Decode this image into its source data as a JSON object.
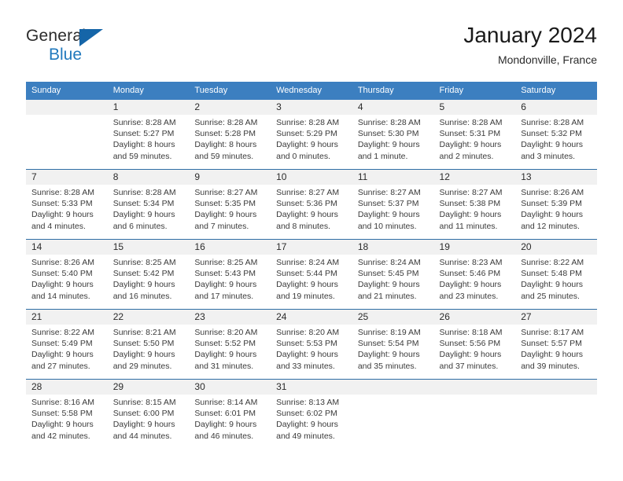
{
  "brand": {
    "name_top": "General",
    "name_bottom": "Blue",
    "triangle_icon": "triangle-logo-icon"
  },
  "header": {
    "title": "January 2024",
    "subtitle": "Mondonville, France"
  },
  "colors": {
    "header_blue": "#3c7fc0",
    "row_divider_blue": "#2e6da4",
    "daynum_band": "#f1f1f1",
    "brand_blue": "#2179bd",
    "logo_triangle": "#1565a8"
  },
  "weekday_headers": [
    "Sunday",
    "Monday",
    "Tuesday",
    "Wednesday",
    "Thursday",
    "Friday",
    "Saturday"
  ],
  "weeks": [
    [
      {
        "day": "",
        "sunrise": "",
        "sunset": "",
        "daylight_line1": "",
        "daylight_line2": ""
      },
      {
        "day": "1",
        "sunrise": "Sunrise: 8:28 AM",
        "sunset": "Sunset: 5:27 PM",
        "daylight_line1": "Daylight: 8 hours",
        "daylight_line2": "and 59 minutes."
      },
      {
        "day": "2",
        "sunrise": "Sunrise: 8:28 AM",
        "sunset": "Sunset: 5:28 PM",
        "daylight_line1": "Daylight: 8 hours",
        "daylight_line2": "and 59 minutes."
      },
      {
        "day": "3",
        "sunrise": "Sunrise: 8:28 AM",
        "sunset": "Sunset: 5:29 PM",
        "daylight_line1": "Daylight: 9 hours",
        "daylight_line2": "and 0 minutes."
      },
      {
        "day": "4",
        "sunrise": "Sunrise: 8:28 AM",
        "sunset": "Sunset: 5:30 PM",
        "daylight_line1": "Daylight: 9 hours",
        "daylight_line2": "and 1 minute."
      },
      {
        "day": "5",
        "sunrise": "Sunrise: 8:28 AM",
        "sunset": "Sunset: 5:31 PM",
        "daylight_line1": "Daylight: 9 hours",
        "daylight_line2": "and 2 minutes."
      },
      {
        "day": "6",
        "sunrise": "Sunrise: 8:28 AM",
        "sunset": "Sunset: 5:32 PM",
        "daylight_line1": "Daylight: 9 hours",
        "daylight_line2": "and 3 minutes."
      }
    ],
    [
      {
        "day": "7",
        "sunrise": "Sunrise: 8:28 AM",
        "sunset": "Sunset: 5:33 PM",
        "daylight_line1": "Daylight: 9 hours",
        "daylight_line2": "and 4 minutes."
      },
      {
        "day": "8",
        "sunrise": "Sunrise: 8:28 AM",
        "sunset": "Sunset: 5:34 PM",
        "daylight_line1": "Daylight: 9 hours",
        "daylight_line2": "and 6 minutes."
      },
      {
        "day": "9",
        "sunrise": "Sunrise: 8:27 AM",
        "sunset": "Sunset: 5:35 PM",
        "daylight_line1": "Daylight: 9 hours",
        "daylight_line2": "and 7 minutes."
      },
      {
        "day": "10",
        "sunrise": "Sunrise: 8:27 AM",
        "sunset": "Sunset: 5:36 PM",
        "daylight_line1": "Daylight: 9 hours",
        "daylight_line2": "and 8 minutes."
      },
      {
        "day": "11",
        "sunrise": "Sunrise: 8:27 AM",
        "sunset": "Sunset: 5:37 PM",
        "daylight_line1": "Daylight: 9 hours",
        "daylight_line2": "and 10 minutes."
      },
      {
        "day": "12",
        "sunrise": "Sunrise: 8:27 AM",
        "sunset": "Sunset: 5:38 PM",
        "daylight_line1": "Daylight: 9 hours",
        "daylight_line2": "and 11 minutes."
      },
      {
        "day": "13",
        "sunrise": "Sunrise: 8:26 AM",
        "sunset": "Sunset: 5:39 PM",
        "daylight_line1": "Daylight: 9 hours",
        "daylight_line2": "and 12 minutes."
      }
    ],
    [
      {
        "day": "14",
        "sunrise": "Sunrise: 8:26 AM",
        "sunset": "Sunset: 5:40 PM",
        "daylight_line1": "Daylight: 9 hours",
        "daylight_line2": "and 14 minutes."
      },
      {
        "day": "15",
        "sunrise": "Sunrise: 8:25 AM",
        "sunset": "Sunset: 5:42 PM",
        "daylight_line1": "Daylight: 9 hours",
        "daylight_line2": "and 16 minutes."
      },
      {
        "day": "16",
        "sunrise": "Sunrise: 8:25 AM",
        "sunset": "Sunset: 5:43 PM",
        "daylight_line1": "Daylight: 9 hours",
        "daylight_line2": "and 17 minutes."
      },
      {
        "day": "17",
        "sunrise": "Sunrise: 8:24 AM",
        "sunset": "Sunset: 5:44 PM",
        "daylight_line1": "Daylight: 9 hours",
        "daylight_line2": "and 19 minutes."
      },
      {
        "day": "18",
        "sunrise": "Sunrise: 8:24 AM",
        "sunset": "Sunset: 5:45 PM",
        "daylight_line1": "Daylight: 9 hours",
        "daylight_line2": "and 21 minutes."
      },
      {
        "day": "19",
        "sunrise": "Sunrise: 8:23 AM",
        "sunset": "Sunset: 5:46 PM",
        "daylight_line1": "Daylight: 9 hours",
        "daylight_line2": "and 23 minutes."
      },
      {
        "day": "20",
        "sunrise": "Sunrise: 8:22 AM",
        "sunset": "Sunset: 5:48 PM",
        "daylight_line1": "Daylight: 9 hours",
        "daylight_line2": "and 25 minutes."
      }
    ],
    [
      {
        "day": "21",
        "sunrise": "Sunrise: 8:22 AM",
        "sunset": "Sunset: 5:49 PM",
        "daylight_line1": "Daylight: 9 hours",
        "daylight_line2": "and 27 minutes."
      },
      {
        "day": "22",
        "sunrise": "Sunrise: 8:21 AM",
        "sunset": "Sunset: 5:50 PM",
        "daylight_line1": "Daylight: 9 hours",
        "daylight_line2": "and 29 minutes."
      },
      {
        "day": "23",
        "sunrise": "Sunrise: 8:20 AM",
        "sunset": "Sunset: 5:52 PM",
        "daylight_line1": "Daylight: 9 hours",
        "daylight_line2": "and 31 minutes."
      },
      {
        "day": "24",
        "sunrise": "Sunrise: 8:20 AM",
        "sunset": "Sunset: 5:53 PM",
        "daylight_line1": "Daylight: 9 hours",
        "daylight_line2": "and 33 minutes."
      },
      {
        "day": "25",
        "sunrise": "Sunrise: 8:19 AM",
        "sunset": "Sunset: 5:54 PM",
        "daylight_line1": "Daylight: 9 hours",
        "daylight_line2": "and 35 minutes."
      },
      {
        "day": "26",
        "sunrise": "Sunrise: 8:18 AM",
        "sunset": "Sunset: 5:56 PM",
        "daylight_line1": "Daylight: 9 hours",
        "daylight_line2": "and 37 minutes."
      },
      {
        "day": "27",
        "sunrise": "Sunrise: 8:17 AM",
        "sunset": "Sunset: 5:57 PM",
        "daylight_line1": "Daylight: 9 hours",
        "daylight_line2": "and 39 minutes."
      }
    ],
    [
      {
        "day": "28",
        "sunrise": "Sunrise: 8:16 AM",
        "sunset": "Sunset: 5:58 PM",
        "daylight_line1": "Daylight: 9 hours",
        "daylight_line2": "and 42 minutes."
      },
      {
        "day": "29",
        "sunrise": "Sunrise: 8:15 AM",
        "sunset": "Sunset: 6:00 PM",
        "daylight_line1": "Daylight: 9 hours",
        "daylight_line2": "and 44 minutes."
      },
      {
        "day": "30",
        "sunrise": "Sunrise: 8:14 AM",
        "sunset": "Sunset: 6:01 PM",
        "daylight_line1": "Daylight: 9 hours",
        "daylight_line2": "and 46 minutes."
      },
      {
        "day": "31",
        "sunrise": "Sunrise: 8:13 AM",
        "sunset": "Sunset: 6:02 PM",
        "daylight_line1": "Daylight: 9 hours",
        "daylight_line2": "and 49 minutes."
      },
      {
        "day": "",
        "sunrise": "",
        "sunset": "",
        "daylight_line1": "",
        "daylight_line2": ""
      },
      {
        "day": "",
        "sunrise": "",
        "sunset": "",
        "daylight_line1": "",
        "daylight_line2": ""
      },
      {
        "day": "",
        "sunrise": "",
        "sunset": "",
        "daylight_line1": "",
        "daylight_line2": ""
      }
    ]
  ]
}
